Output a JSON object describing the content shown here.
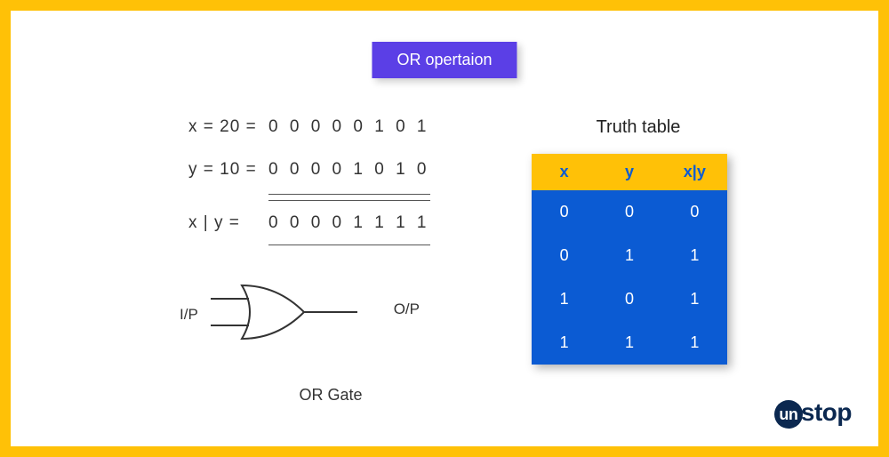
{
  "title": "OR opertaion",
  "equations": {
    "x_label": "x = 20 =",
    "x_bits": "0 0 0 0 0 1 0 1",
    "y_label": "y = 10 =",
    "y_bits": "0 0 0 0 1 0 1 0",
    "result_label": "x | y  =",
    "result_bits": "0 0 0 0 1 1 1 1"
  },
  "gate": {
    "input_label": "I/P",
    "output_label": "O/P",
    "caption": "OR Gate"
  },
  "truth": {
    "title": "Truth table",
    "headers": [
      "x",
      "y",
      "x|y"
    ],
    "rows": [
      [
        "0",
        "0",
        "0"
      ],
      [
        "0",
        "1",
        "1"
      ],
      [
        "1",
        "0",
        "1"
      ],
      [
        "1",
        "1",
        "1"
      ]
    ]
  },
  "logo": {
    "first": "un",
    "rest": "stop"
  },
  "colors": {
    "border": "#FFC107",
    "badge": "#5B3FE6",
    "table_bg": "#0B5BD3",
    "logo": "#0B2850"
  }
}
